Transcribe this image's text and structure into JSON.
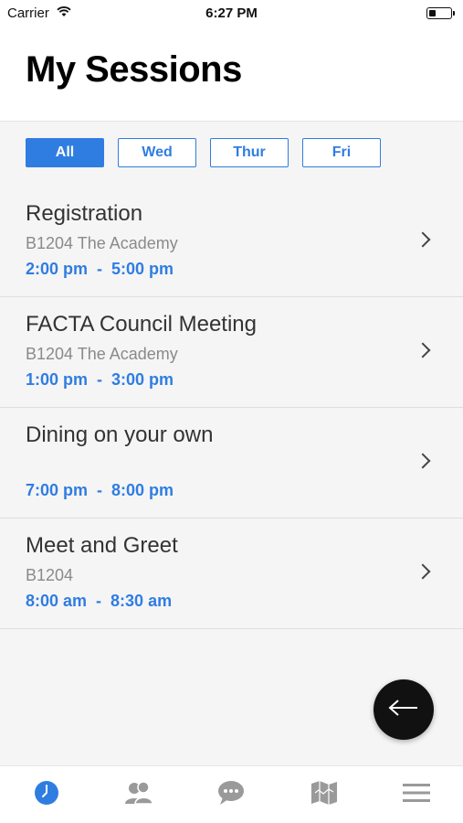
{
  "status_bar": {
    "carrier": "Carrier",
    "time": "6:27 PM",
    "battery_level": 0.3
  },
  "header": {
    "title": "My Sessions"
  },
  "filters": [
    {
      "label": "All",
      "active": true
    },
    {
      "label": "Wed",
      "active": false
    },
    {
      "label": "Thur",
      "active": false
    },
    {
      "label": "Fri",
      "active": false
    }
  ],
  "sessions": [
    {
      "title": "Registration",
      "location": "B1204 The Academy",
      "time": "2:00 pm  -  5:00 pm"
    },
    {
      "title": "FACTA Council Meeting",
      "location": "B1204 The Academy",
      "time": "1:00 pm  -  3:00 pm"
    },
    {
      "title": "Dining on your own",
      "location": "",
      "time": "7:00 pm  -  8:00 pm"
    },
    {
      "title": "Meet and Greet",
      "location": "B1204",
      "time": "8:00 am  -  8:30 am"
    }
  ],
  "fab": {
    "icon": "back-arrow-icon"
  },
  "tab_bar": {
    "items": [
      {
        "icon": "clock-icon",
        "active": true
      },
      {
        "icon": "people-icon",
        "active": false
      },
      {
        "icon": "chat-icon",
        "active": false
      },
      {
        "icon": "map-icon",
        "active": false
      },
      {
        "icon": "menu-icon",
        "active": false
      }
    ]
  },
  "colors": {
    "accent": "#2f7de1",
    "inactive_icon": "#9a9a9a",
    "background": "#f5f5f5"
  }
}
